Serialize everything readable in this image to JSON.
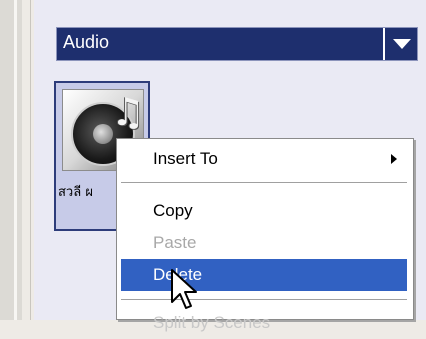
{
  "dropdown": {
    "value": "Audio"
  },
  "media_item": {
    "label": "สวลี ผ"
  },
  "context_menu": {
    "items": [
      {
        "label": "Insert To",
        "state": "normal",
        "has_submenu": true
      },
      {
        "label": "Copy",
        "state": "normal"
      },
      {
        "label": "Paste",
        "state": "disabled"
      },
      {
        "label": "Delete",
        "state": "highlighted"
      },
      {
        "label": "Split by Scenes",
        "state": "partially-visible"
      }
    ],
    "highlight_color": "#3161c2"
  },
  "icons": {
    "dropdown_arrow": "chevron-down-icon",
    "thumbnail": "speaker-music-icon",
    "cursor": "mouse-pointer-icon"
  }
}
